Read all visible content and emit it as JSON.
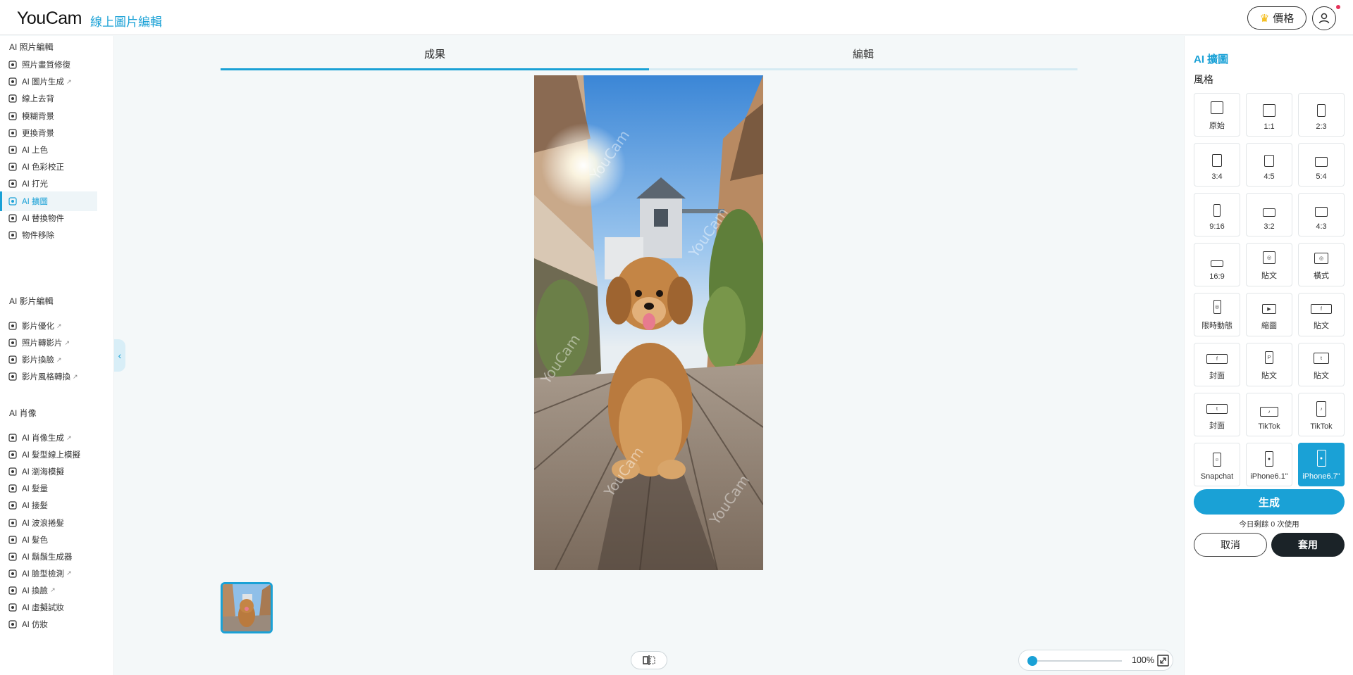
{
  "header": {
    "logo": "YouCam",
    "product": "線上圖片編輯",
    "price_label": "價格"
  },
  "sidebar": {
    "sections": [
      {
        "title": "AI 照片編輯",
        "items": [
          {
            "label": "照片畫質修復",
            "icon": "photo-enhance-icon",
            "external": false
          },
          {
            "label": "AI 圖片生成",
            "icon": "ai-image-icon",
            "external": true
          },
          {
            "label": "線上去背",
            "icon": "remove-bg-icon",
            "external": false
          },
          {
            "label": "模糊背景",
            "icon": "blur-icon",
            "external": false
          },
          {
            "label": "更換背景",
            "icon": "change-bg-icon",
            "external": false
          },
          {
            "label": "AI 上色",
            "icon": "colorize-icon",
            "external": false
          },
          {
            "label": "AI 色彩校正",
            "icon": "color-wheel-icon",
            "external": false
          },
          {
            "label": "AI 打光",
            "icon": "light-icon",
            "external": false
          },
          {
            "label": "AI 擴圖",
            "icon": "expand-icon",
            "external": false,
            "active": true
          },
          {
            "label": "AI 替換物件",
            "icon": "replace-icon",
            "external": false
          },
          {
            "label": "物件移除",
            "icon": "eraser-icon",
            "external": false
          }
        ]
      },
      {
        "title": "AI 影片編輯",
        "items": [
          {
            "label": "影片優化",
            "icon": "video-enhance-icon",
            "external": true
          },
          {
            "label": "照片轉影片",
            "icon": "photo-to-video-icon",
            "external": true
          },
          {
            "label": "影片換臉",
            "icon": "video-face-swap-icon",
            "external": true
          },
          {
            "label": "影片風格轉換",
            "icon": "video-style-icon",
            "external": true
          }
        ]
      },
      {
        "title": "AI 肖像",
        "items": [
          {
            "label": "AI 肖像生成",
            "icon": "portrait-icon",
            "external": true
          },
          {
            "label": "AI 髮型線上模擬",
            "icon": "hairstyle-icon",
            "external": false
          },
          {
            "label": "AI 瀏海模擬",
            "icon": "bangs-icon",
            "external": false
          },
          {
            "label": "AI 髮量",
            "icon": "hair-volume-icon",
            "external": false
          },
          {
            "label": "AI 接髮",
            "icon": "hair-extension-icon",
            "external": false
          },
          {
            "label": "AI 波浪捲髮",
            "icon": "wavy-hair-icon",
            "external": false
          },
          {
            "label": "AI 髮色",
            "icon": "hair-color-icon",
            "external": false
          },
          {
            "label": "AI 鬍鬚生成器",
            "icon": "beard-icon",
            "external": false
          },
          {
            "label": "AI 臉型檢測",
            "icon": "face-shape-icon",
            "external": true
          },
          {
            "label": "AI 換臉",
            "icon": "face-swap-icon",
            "external": true
          },
          {
            "label": "AI 虛擬試妝",
            "icon": "makeup-icon",
            "external": false
          },
          {
            "label": "AI 仿妝",
            "icon": "copy-makeup-icon",
            "external": false
          }
        ]
      }
    ]
  },
  "main": {
    "tabs": [
      {
        "label": "成果",
        "active": true
      },
      {
        "label": "編輯",
        "active": false
      }
    ],
    "zoom": "100%",
    "watermark": "YouCam"
  },
  "panel": {
    "title": "AI 擴圖",
    "subtitle": "風格",
    "ratios": [
      {
        "label": "原始",
        "w": 18,
        "h": 18
      },
      {
        "label": "1:1",
        "w": 18,
        "h": 18
      },
      {
        "label": "2:3",
        "w": 12,
        "h": 18
      },
      {
        "label": "3:4",
        "w": 14,
        "h": 18
      },
      {
        "label": "4:5",
        "w": 14,
        "h": 17
      },
      {
        "label": "5:4",
        "w": 18,
        "h": 14
      },
      {
        "label": "9:16",
        "w": 10,
        "h": 18
      },
      {
        "label": "3:2",
        "w": 18,
        "h": 12
      },
      {
        "label": "4:3",
        "w": 18,
        "h": 14
      },
      {
        "label": "16:9",
        "w": 18,
        "h": 9
      },
      {
        "label": "貼文",
        "w": 18,
        "h": 18,
        "glyph": "instagram-icon"
      },
      {
        "label": "橫式",
        "w": 20,
        "h": 16,
        "glyph": "instagram-icon"
      },
      {
        "label": "限時動態",
        "w": 11,
        "h": 20,
        "glyph": "instagram-icon"
      },
      {
        "label": "縮圖",
        "w": 20,
        "h": 14,
        "glyph": "youtube-icon"
      },
      {
        "label": "貼文",
        "w": 30,
        "h": 14,
        "glyph": "facebook-icon"
      },
      {
        "label": "封面",
        "w": 30,
        "h": 14,
        "glyph": "facebook-icon"
      },
      {
        "label": "貼文",
        "w": 12,
        "h": 18,
        "glyph": "pinterest-icon"
      },
      {
        "label": "貼文",
        "w": 22,
        "h": 16,
        "glyph": "twitter-icon"
      },
      {
        "label": "封面",
        "w": 30,
        "h": 14,
        "glyph": "twitter-icon"
      },
      {
        "label": "TikTok",
        "w": 26,
        "h": 14,
        "glyph": "tiktok-icon"
      },
      {
        "label": "TikTok",
        "w": 14,
        "h": 22,
        "glyph": "tiktok-icon"
      },
      {
        "label": "Snapchat",
        "w": 12,
        "h": 20,
        "glyph": "snapchat-icon"
      },
      {
        "label": "iPhone6.1\"",
        "w": 12,
        "h": 22,
        "glyph": "apple-icon"
      },
      {
        "label": "iPhone6.7\"",
        "w": 13,
        "h": 24,
        "glyph": "apple-icon",
        "selected": true
      }
    ],
    "generate_label": "生成",
    "remaining_text": "今日剩餘 0 次使用",
    "cancel_label": "取消",
    "apply_label": "套用"
  }
}
